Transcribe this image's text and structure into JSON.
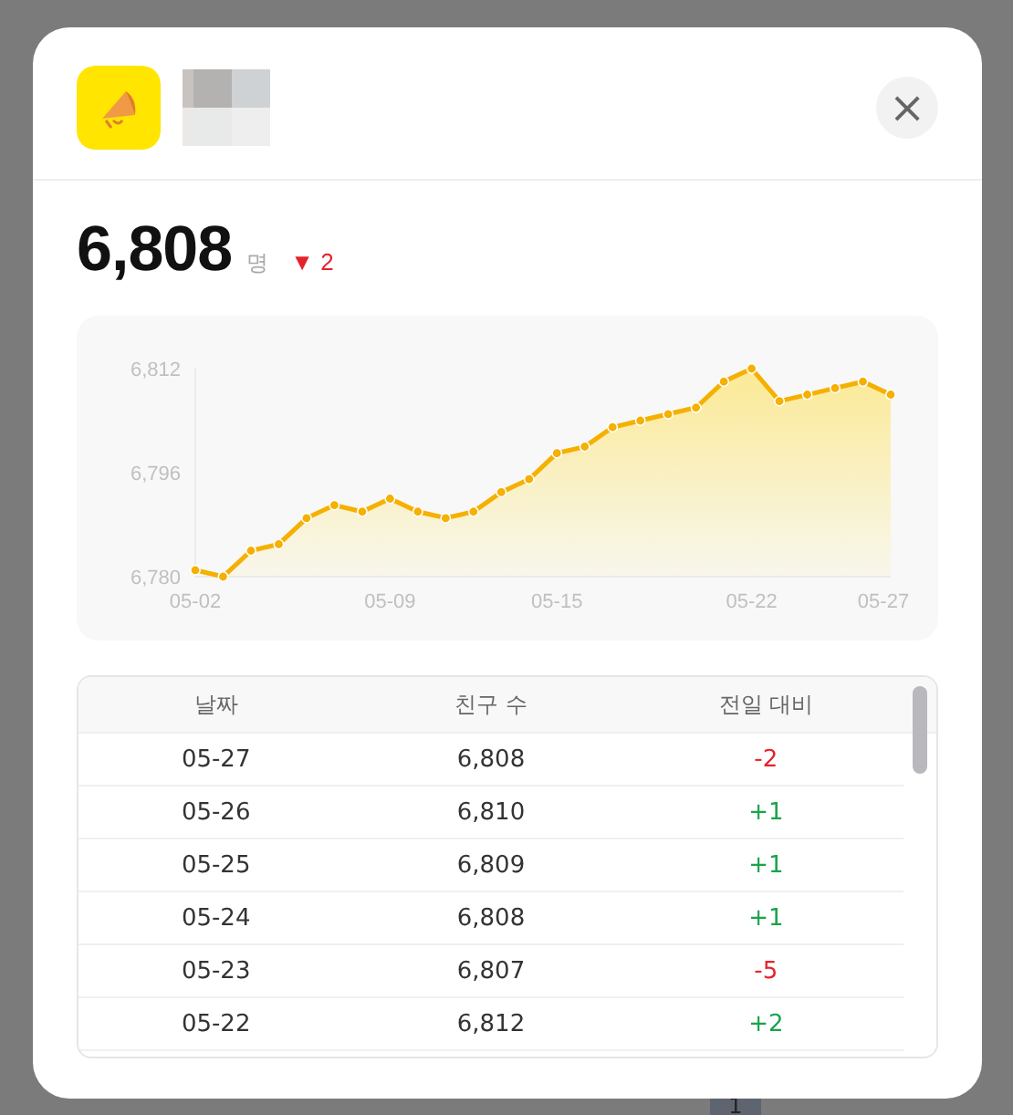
{
  "header": {
    "close_label": "×"
  },
  "summary": {
    "count": "6,808",
    "unit": "명",
    "change_symbol": "▼",
    "change": "2",
    "color": "#e5222c"
  },
  "chart_data": {
    "type": "area",
    "categories": [
      "05-02",
      null,
      null,
      null,
      null,
      null,
      null,
      "05-09",
      null,
      null,
      null,
      null,
      null,
      "05-15",
      null,
      null,
      null,
      null,
      null,
      null,
      "05-22",
      null,
      null,
      null,
      null,
      "05-27"
    ],
    "series": [
      {
        "color": "#f5b000",
        "values": [
          6781,
          6780,
          6784,
          6785,
          6789,
          6791,
          6790,
          6792,
          6790,
          6789,
          6790,
          6793,
          6795,
          6799,
          6800,
          6803,
          6804,
          6805,
          6806,
          6810,
          6812,
          6807,
          6808,
          6809,
          6810,
          6808
        ]
      }
    ],
    "ylim": [
      6780,
      6812
    ],
    "yticks": [
      {
        "value": 6780,
        "label": "6,780"
      },
      {
        "value": 6796,
        "label": "6,796"
      },
      {
        "value": 6812,
        "label": "6,812"
      }
    ]
  },
  "table": {
    "columns": [
      "날짜",
      "친구 수",
      "전일 대비"
    ],
    "rows": [
      {
        "date": "05-27",
        "count": "6,808",
        "diff": "-2",
        "color": "#e5222c"
      },
      {
        "date": "05-26",
        "count": "6,810",
        "diff": "+1",
        "color": "#1aa34a"
      },
      {
        "date": "05-25",
        "count": "6,809",
        "diff": "+1",
        "color": "#1aa34a"
      },
      {
        "date": "05-24",
        "count": "6,808",
        "diff": "+1",
        "color": "#1aa34a"
      },
      {
        "date": "05-23",
        "count": "6,807",
        "diff": "-5",
        "color": "#e5222c"
      },
      {
        "date": "05-22",
        "count": "6,812",
        "diff": "+2",
        "color": "#1aa34a"
      }
    ]
  },
  "background": {
    "page_number": "1"
  }
}
